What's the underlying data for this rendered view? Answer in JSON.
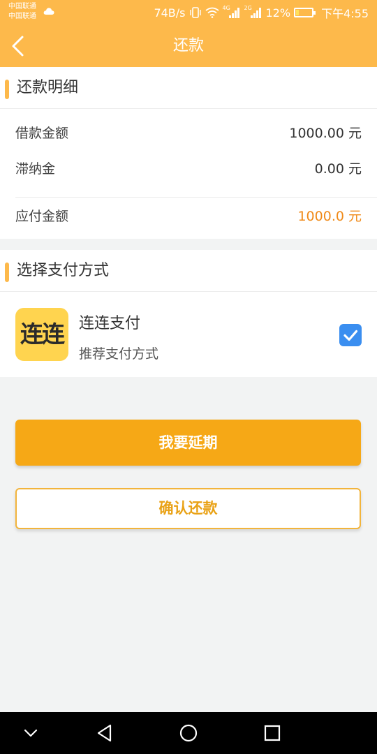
{
  "status_bar": {
    "carrier_1": "中国联通",
    "carrier_2": "中国联通",
    "speed": "74B/s",
    "signal_tag_1": "4G",
    "signal_tag_2": "2G",
    "battery": "12%",
    "time": "下午4:55"
  },
  "nav": {
    "title": "还款"
  },
  "detail": {
    "title": "还款明细",
    "loan_label": "借款金额",
    "loan_value": "1000.00 元",
    "late_fee_label": "滞纳金",
    "late_fee_value": "0.00 元",
    "payable_label": "应付金额",
    "payable_value": "1000.0 元"
  },
  "payment": {
    "title": "选择支付方式",
    "logo_text": "连连",
    "method_name": "连连支付",
    "method_sub": "推荐支付方式",
    "selected": true
  },
  "buttons": {
    "extend": "我要延期",
    "confirm": "确认还款"
  },
  "colors": {
    "brand": "#fdb94b",
    "accent_orange": "#f08a18",
    "button_primary": "#f6a816",
    "checkbox": "#3a8ef0"
  }
}
